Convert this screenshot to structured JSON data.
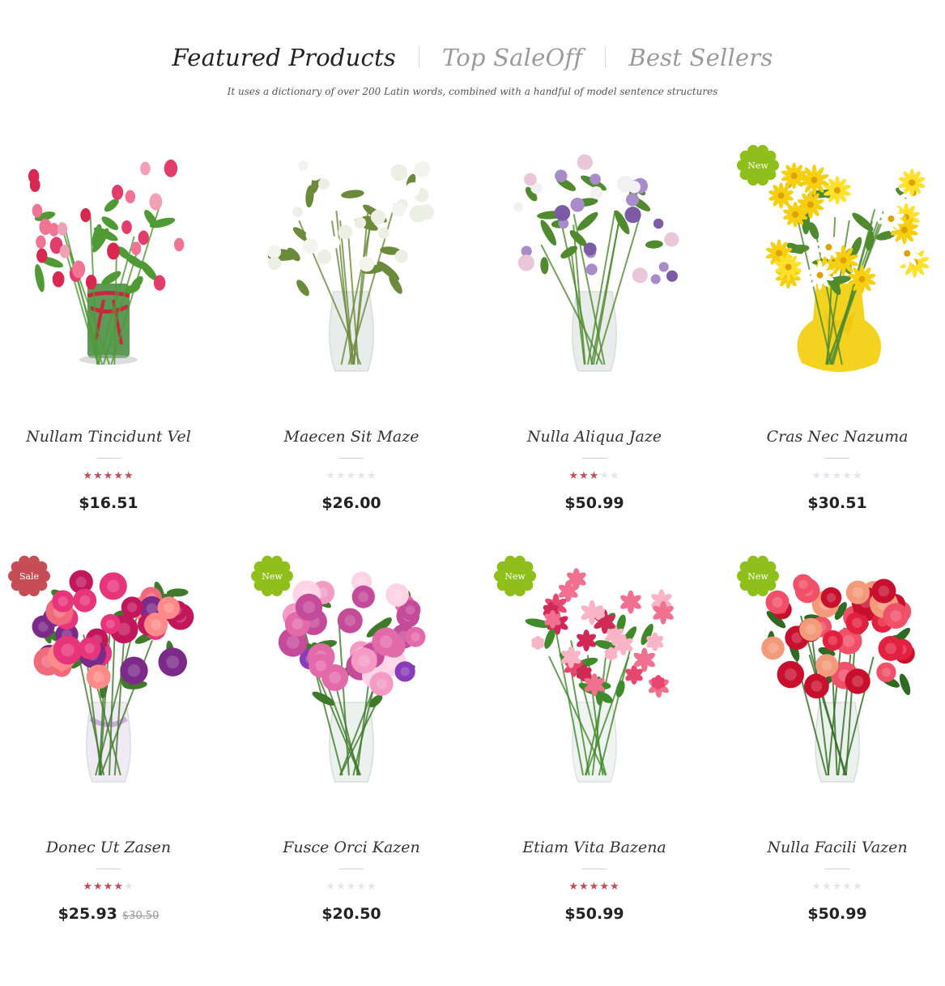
{
  "tabs": [
    {
      "label": "Featured Products",
      "active": true
    },
    {
      "label": "Top SaleOff",
      "active": false
    },
    {
      "label": "Best Sellers",
      "active": false
    }
  ],
  "subtitle": "It uses a dictionary of over 200 Latin words, combined with a handful of model sentence structures",
  "colors": {
    "star_on": "#c64d56",
    "star_off": "#e3e6ea",
    "badge_new": "#8fbf1a",
    "badge_sale": "#c64d56"
  },
  "products": [
    {
      "name": "Nullam Tincidunt Vel",
      "rating": 5,
      "price": "$16.51",
      "old_price": "",
      "badge": "",
      "image": "pink-tulip-bouquet-in-vase-image"
    },
    {
      "name": "Maecen Sit Maze",
      "rating": 0,
      "price": "$26.00",
      "old_price": "",
      "badge": "",
      "image": "white-blossom-bouquet-in-vase-image"
    },
    {
      "name": "Nulla Aliqua Jaze",
      "rating": 3,
      "price": "$50.99",
      "old_price": "",
      "badge": "",
      "image": "lilac-bouquet-in-vase-image"
    },
    {
      "name": "Cras Nec Nazuma",
      "rating": 0,
      "price": "$30.51",
      "old_price": "",
      "badge": "New",
      "image": "daisy-bouquet-yellow-vase-image"
    },
    {
      "name": "Donec Ut Zasen",
      "rating": 4,
      "price": "$25.93",
      "old_price": "$30.50",
      "badge": "Sale",
      "image": "pink-purple-mixed-bouquet-image"
    },
    {
      "name": "Fusce Orci Kazen",
      "rating": 0,
      "price": "$20.50",
      "old_price": "",
      "badge": "New",
      "image": "pink-rose-daisy-bouquet-image"
    },
    {
      "name": "Etiam Vita Bazena",
      "rating": 5,
      "price": "$50.99",
      "old_price": "",
      "badge": "New",
      "image": "stargazer-lily-bouquet-image"
    },
    {
      "name": "Nulla Facili Vazen",
      "rating": 0,
      "price": "$50.99",
      "old_price": "",
      "badge": "New",
      "image": "red-rose-bouquet-in-vase-image"
    }
  ]
}
